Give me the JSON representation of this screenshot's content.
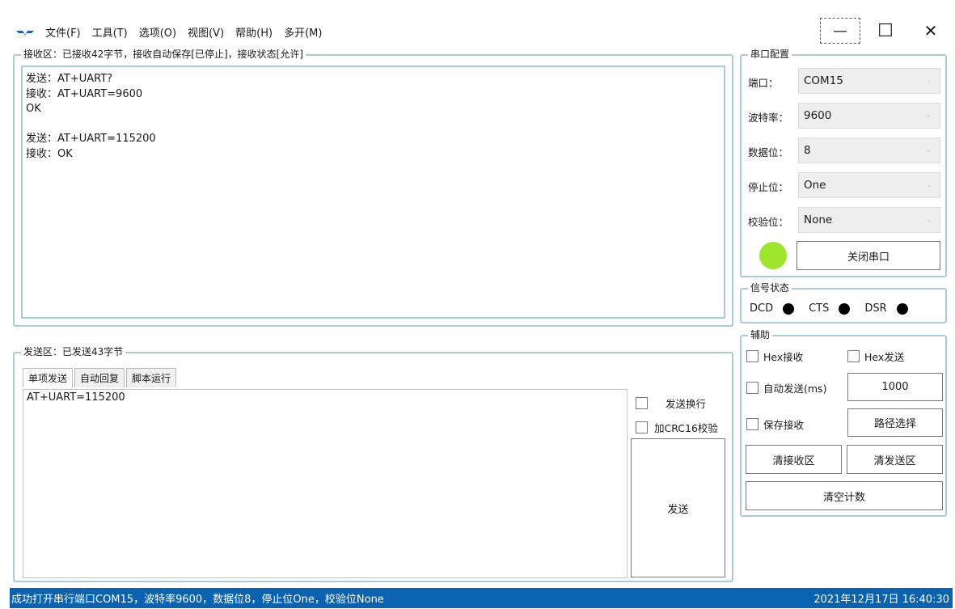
{
  "menu": {
    "items": [
      "文件(F)",
      "工具(T)",
      "选项(O)",
      "视图(V)",
      "帮助(H)",
      "多开(M)"
    ]
  },
  "window_controls": {
    "minimize": "—",
    "maximize": "☐",
    "close": "✕"
  },
  "recv": {
    "title": "接收区：已接收42字节，接收自动保存[已停止]，接收状态[允许]",
    "lines": [
      "发送：AT+UART?",
      "接收：AT+UART=9600",
      "OK",
      "",
      "发送：AT+UART=115200",
      "接收：OK"
    ]
  },
  "send": {
    "title": "发送区：已发送43字节",
    "tabs": [
      "单项发送",
      "自动回复",
      "脚本运行"
    ],
    "active_tab": 0,
    "text": "AT+UART=115200",
    "newline_label": "发送换行",
    "crc_label": "加CRC16校验",
    "send_button": "发送"
  },
  "serial": {
    "title": "串口配置",
    "fields": [
      {
        "label": "端口：",
        "value": "COM15"
      },
      {
        "label": "波特率：",
        "value": "9600"
      },
      {
        "label": "数据位：",
        "value": "8"
      },
      {
        "label": "停止位：",
        "value": "One"
      },
      {
        "label": "校验位：",
        "value": "None"
      }
    ],
    "close_button": "关闭串口",
    "led_color": "#9ee62b"
  },
  "signal": {
    "title": "信号状态",
    "items": [
      "DCD",
      "CTS",
      "DSR"
    ]
  },
  "assist": {
    "title": "辅助",
    "hex_recv": "Hex接收",
    "hex_send": "Hex发送",
    "auto_send": "自动发送(ms)",
    "interval": "1000",
    "save_recv": "保存接收",
    "path_button": "路径选择",
    "clear_recv_button": "清接收区",
    "clear_send_button": "清发送区",
    "clear_count_button": "清空计数"
  },
  "status": {
    "message": "成功打开串行端口COM15，波特率9600，数据位8，停止位One，校验位None",
    "datetime": "2021年12月17日 16:40:30"
  },
  "colors": {
    "accent": "#0a63b0",
    "border": "#a9cdd6"
  }
}
